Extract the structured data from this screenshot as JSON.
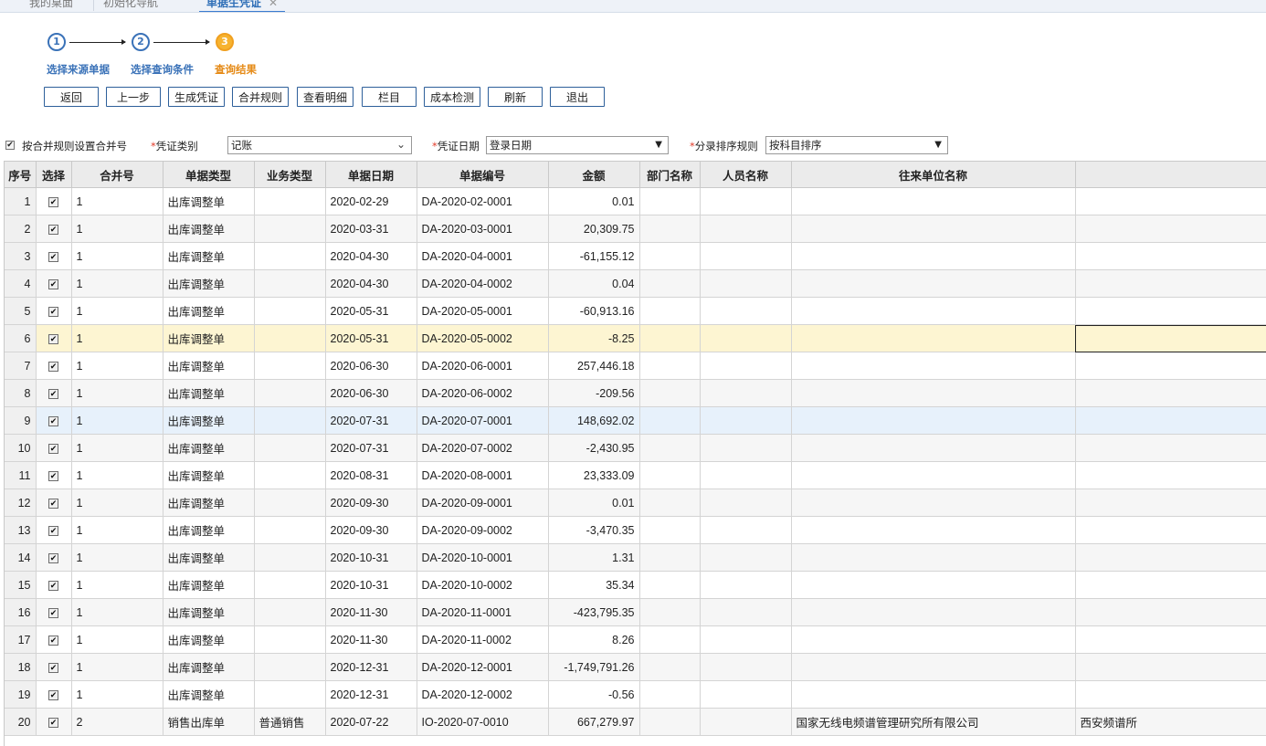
{
  "tabs": [
    {
      "label": "我的桌面"
    },
    {
      "label": "初始化导航"
    },
    {
      "label": "单据生凭证",
      "close": "✕"
    }
  ],
  "stepper": {
    "steps": [
      {
        "num": "1",
        "label": "选择来源单据"
      },
      {
        "num": "2",
        "label": "选择查询条件"
      },
      {
        "num": "3",
        "label": "查询结果"
      }
    ]
  },
  "toolbar": {
    "back": "返回",
    "prev": "上一步",
    "generate": "生成凭证",
    "merge_rule": "合并规则",
    "detail": "查看明细",
    "columns": "栏目",
    "cost_check": "成本检测",
    "refresh": "刷新",
    "exit": "退出"
  },
  "options": {
    "merge_check_label": "按合并规则设置合并号",
    "merge_checked": true,
    "voucher_type_label": "凭证类别",
    "voucher_type_value": "记账",
    "voucher_date_label": "凭证日期",
    "voucher_date_value": "登录日期",
    "sort_rule_label": "分录排序规则",
    "sort_rule_value": "按科目排序",
    "required_mark": "*"
  },
  "grid": {
    "columns": [
      "序号",
      "选择",
      "合并号",
      "单据类型",
      "业务类型",
      "单据日期",
      "单据编号",
      "金额",
      "部门名称",
      "人员名称",
      "往来单位名称",
      ""
    ],
    "rows": [
      {
        "seq": "1",
        "merge": "1",
        "doc_type": "出库调整单",
        "biz_type": "",
        "date": "2020-02-29",
        "doc_no": "DA-2020-02-0001",
        "amount": "0.01",
        "dept": "",
        "person": "",
        "partner": "",
        "extra": ""
      },
      {
        "seq": "2",
        "merge": "1",
        "doc_type": "出库调整单",
        "biz_type": "",
        "date": "2020-03-31",
        "doc_no": "DA-2020-03-0001",
        "amount": "20,309.75",
        "dept": "",
        "person": "",
        "partner": "",
        "extra": ""
      },
      {
        "seq": "3",
        "merge": "1",
        "doc_type": "出库调整单",
        "biz_type": "",
        "date": "2020-04-30",
        "doc_no": "DA-2020-04-0001",
        "amount": "-61,155.12",
        "dept": "",
        "person": "",
        "partner": "",
        "extra": ""
      },
      {
        "seq": "4",
        "merge": "1",
        "doc_type": "出库调整单",
        "biz_type": "",
        "date": "2020-04-30",
        "doc_no": "DA-2020-04-0002",
        "amount": "0.04",
        "dept": "",
        "person": "",
        "partner": "",
        "extra": ""
      },
      {
        "seq": "5",
        "merge": "1",
        "doc_type": "出库调整单",
        "biz_type": "",
        "date": "2020-05-31",
        "doc_no": "DA-2020-05-0001",
        "amount": "-60,913.16",
        "dept": "",
        "person": "",
        "partner": "",
        "extra": ""
      },
      {
        "seq": "6",
        "merge": "1",
        "doc_type": "出库调整单",
        "biz_type": "",
        "date": "2020-05-31",
        "doc_no": "DA-2020-05-0002",
        "amount": "-8.25",
        "dept": "",
        "person": "",
        "partner": "",
        "extra": ""
      },
      {
        "seq": "7",
        "merge": "1",
        "doc_type": "出库调整单",
        "biz_type": "",
        "date": "2020-06-30",
        "doc_no": "DA-2020-06-0001",
        "amount": "257,446.18",
        "dept": "",
        "person": "",
        "partner": "",
        "extra": ""
      },
      {
        "seq": "8",
        "merge": "1",
        "doc_type": "出库调整单",
        "biz_type": "",
        "date": "2020-06-30",
        "doc_no": "DA-2020-06-0002",
        "amount": "-209.56",
        "dept": "",
        "person": "",
        "partner": "",
        "extra": ""
      },
      {
        "seq": "9",
        "merge": "1",
        "doc_type": "出库调整单",
        "biz_type": "",
        "date": "2020-07-31",
        "doc_no": "DA-2020-07-0001",
        "amount": "148,692.02",
        "dept": "",
        "person": "",
        "partner": "",
        "extra": ""
      },
      {
        "seq": "10",
        "merge": "1",
        "doc_type": "出库调整单",
        "biz_type": "",
        "date": "2020-07-31",
        "doc_no": "DA-2020-07-0002",
        "amount": "-2,430.95",
        "dept": "",
        "person": "",
        "partner": "",
        "extra": ""
      },
      {
        "seq": "11",
        "merge": "1",
        "doc_type": "出库调整单",
        "biz_type": "",
        "date": "2020-08-31",
        "doc_no": "DA-2020-08-0001",
        "amount": "23,333.09",
        "dept": "",
        "person": "",
        "partner": "",
        "extra": ""
      },
      {
        "seq": "12",
        "merge": "1",
        "doc_type": "出库调整单",
        "biz_type": "",
        "date": "2020-09-30",
        "doc_no": "DA-2020-09-0001",
        "amount": "0.01",
        "dept": "",
        "person": "",
        "partner": "",
        "extra": ""
      },
      {
        "seq": "13",
        "merge": "1",
        "doc_type": "出库调整单",
        "biz_type": "",
        "date": "2020-09-30",
        "doc_no": "DA-2020-09-0002",
        "amount": "-3,470.35",
        "dept": "",
        "person": "",
        "partner": "",
        "extra": ""
      },
      {
        "seq": "14",
        "merge": "1",
        "doc_type": "出库调整单",
        "biz_type": "",
        "date": "2020-10-31",
        "doc_no": "DA-2020-10-0001",
        "amount": "1.31",
        "dept": "",
        "person": "",
        "partner": "",
        "extra": ""
      },
      {
        "seq": "15",
        "merge": "1",
        "doc_type": "出库调整单",
        "biz_type": "",
        "date": "2020-10-31",
        "doc_no": "DA-2020-10-0002",
        "amount": "35.34",
        "dept": "",
        "person": "",
        "partner": "",
        "extra": ""
      },
      {
        "seq": "16",
        "merge": "1",
        "doc_type": "出库调整单",
        "biz_type": "",
        "date": "2020-11-30",
        "doc_no": "DA-2020-11-0001",
        "amount": "-423,795.35",
        "dept": "",
        "person": "",
        "partner": "",
        "extra": ""
      },
      {
        "seq": "17",
        "merge": "1",
        "doc_type": "出库调整单",
        "biz_type": "",
        "date": "2020-11-30",
        "doc_no": "DA-2020-11-0002",
        "amount": "8.26",
        "dept": "",
        "person": "",
        "partner": "",
        "extra": ""
      },
      {
        "seq": "18",
        "merge": "1",
        "doc_type": "出库调整单",
        "biz_type": "",
        "date": "2020-12-31",
        "doc_no": "DA-2020-12-0001",
        "amount": "-1,749,791.26",
        "dept": "",
        "person": "",
        "partner": "",
        "extra": ""
      },
      {
        "seq": "19",
        "merge": "1",
        "doc_type": "出库调整单",
        "biz_type": "",
        "date": "2020-12-31",
        "doc_no": "DA-2020-12-0002",
        "amount": "-0.56",
        "dept": "",
        "person": "",
        "partner": "",
        "extra": ""
      },
      {
        "seq": "20",
        "merge": "2",
        "doc_type": "销售出库单",
        "biz_type": "普通销售",
        "date": "2020-07-22",
        "doc_no": "IO-2020-07-0010",
        "amount": "667,279.97",
        "dept": "",
        "person": "",
        "partner": "国家无线电频谱管理研究所有限公司",
        "extra": "西安频谱所"
      }
    ],
    "highlight_row": 5,
    "selected_row": 8,
    "colors": {
      "negative": "#e5271d",
      "highlight": "#fdf5d2",
      "selected": "#e7f1fb",
      "accent": "#3a72b8",
      "current_step": "#f7b330"
    }
  }
}
